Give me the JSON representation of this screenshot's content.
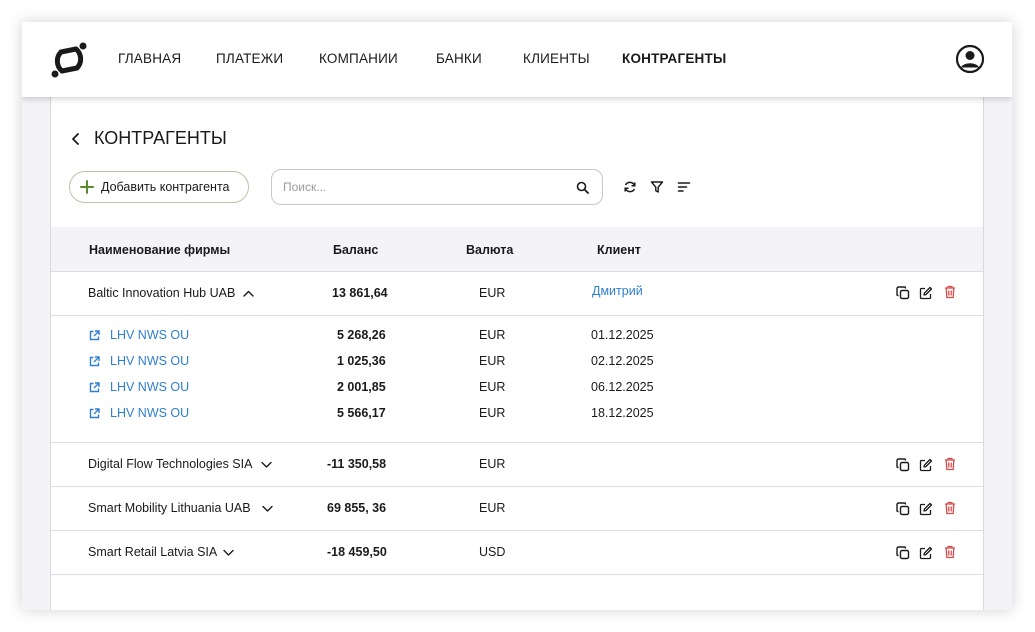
{
  "nav": {
    "items": [
      {
        "label": "ГЛАВНАЯ",
        "active": false
      },
      {
        "label": "ПЛАТЕЖИ",
        "active": false
      },
      {
        "label": "КОМПАНИИ",
        "active": false
      },
      {
        "label": "БАНКИ",
        "active": false
      },
      {
        "label": "КЛИЕНТЫ",
        "active": false
      },
      {
        "label": "КОНТРАГЕНТЫ",
        "active": true
      }
    ]
  },
  "page": {
    "title": "КОНТРАГЕНТЫ"
  },
  "toolbar": {
    "add_label": "Добавить контрагента",
    "search_placeholder": "Поиск..."
  },
  "table": {
    "headers": [
      "Наименование фирмы",
      "Баланс",
      "Валюта",
      "Клиент"
    ],
    "rows": [
      {
        "name": "Baltic Innovation Hub UAB",
        "balance": "13 861,64",
        "currency": "EUR",
        "client": "Дмитрий",
        "expanded": true,
        "children": [
          {
            "name": "LHV NWS OU",
            "balance": "5 268,26",
            "currency": "EUR",
            "date": "01.12.2025"
          },
          {
            "name": "LHV NWS OU",
            "balance": "1 025,36",
            "currency": "EUR",
            "date": "02.12.2025"
          },
          {
            "name": "LHV NWS OU",
            "balance": "2 001,85",
            "currency": "EUR",
            "date": "06.12.2025"
          },
          {
            "name": "LHV NWS OU",
            "balance": "5 566,17",
            "currency": "EUR",
            "date": "18.12.2025"
          }
        ]
      },
      {
        "name": "Digital Flow Technologies SIA",
        "balance": "-11 350,58",
        "currency": "EUR",
        "client": "",
        "expanded": false
      },
      {
        "name": "Smart Mobility Lithuania UAB",
        "balance": "69 855, 36",
        "currency": "EUR",
        "client": "",
        "expanded": false
      },
      {
        "name": "Smart Retail Latvia SIA",
        "balance": "-18 459,50",
        "currency": "USD",
        "client": "",
        "expanded": false
      }
    ]
  },
  "icons": {
    "logo": "brand-logo",
    "profile": "user-circle-icon",
    "back": "chevron-left-icon",
    "add": "plus-icon",
    "search": "search-icon",
    "refresh": "refresh-icon",
    "filter": "filter-icon",
    "sort": "sort-icon",
    "copy": "copy-icon",
    "edit": "edit-icon",
    "delete": "trash-icon",
    "external": "external-link-icon"
  },
  "colors": {
    "accent_link": "#2f7fd1",
    "add_plus": "#5a8a2a",
    "delete": "#d84a4a",
    "header_bg": "#f4f4f8"
  }
}
